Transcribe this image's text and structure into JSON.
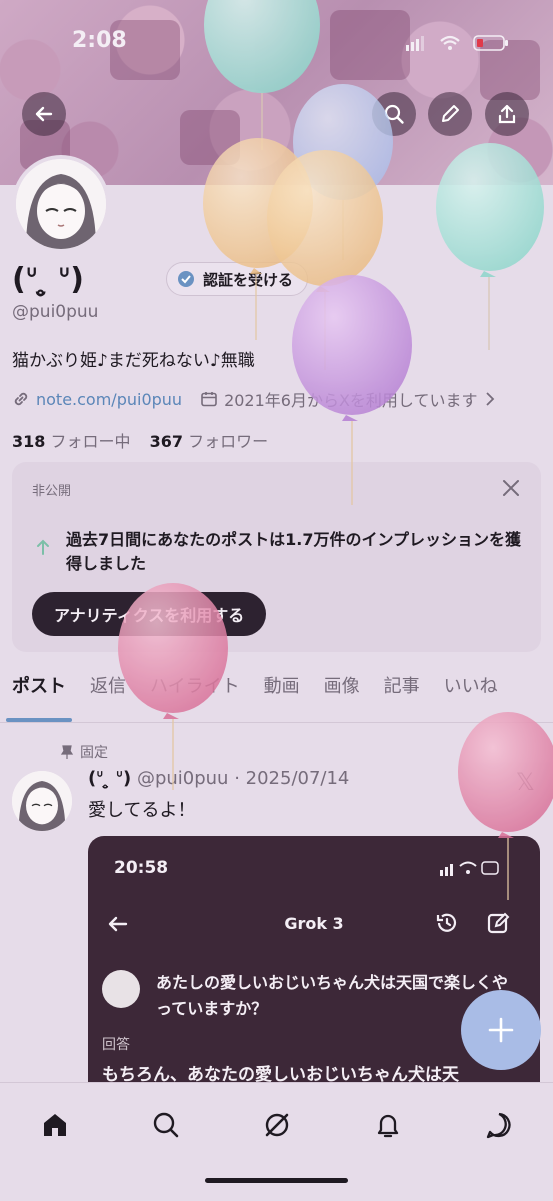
{
  "status_bar": {
    "time": "2:08"
  },
  "header_buttons": [
    "back-arrow-icon",
    "search-icon",
    "pencil-icon",
    "share-icon"
  ],
  "profile": {
    "display_name": "(ᐡ ̥̮ ᐡ)",
    "verify_label": "認証を受ける",
    "handle": "@pui0puu",
    "bio": "猫かぶり姫♪まだ死ねない♪無職",
    "link": "note.com/pui0puu",
    "joined": "2021年6月からXを利用しています",
    "following_count": "318",
    "following_label": "フォロー中",
    "followers_count": "367",
    "followers_label": "フォロワー"
  },
  "analytics_card": {
    "label": "非公開",
    "text": "過去7日間にあなたのポストは1.7万件のインプレッションを獲得しました",
    "button": "アナリティクスを利用する"
  },
  "tabs": [
    {
      "label": "ポスト",
      "active": true
    },
    {
      "label": "返信"
    },
    {
      "label": "ハイライト"
    },
    {
      "label": "動画"
    },
    {
      "label": "画像"
    },
    {
      "label": "記事"
    },
    {
      "label": "いいね"
    }
  ],
  "post": {
    "pinned_label": "固定",
    "name": "(ᐡ ̥̮ ᐡ)",
    "handle_date": "@pui0puu · 2025/07/14",
    "text": "愛してるよ！",
    "media": {
      "time": "20:58",
      "title": "Grok 3",
      "question": "あたしの愛しいおじいちゃん犬は天国で楽しくやっていますか？",
      "answer_label": "回答",
      "answer": "もちろん、あなたの愛しいおじいちゃん犬は天"
    }
  },
  "bottom_nav": [
    "home-icon",
    "search-icon",
    "grok-icon",
    "bell-icon",
    "messages-icon"
  ],
  "colors": {
    "background": "#e6dce9",
    "accent": "#6a92c2",
    "fab": "#a9bce6",
    "media_bg": "#3d2838"
  }
}
